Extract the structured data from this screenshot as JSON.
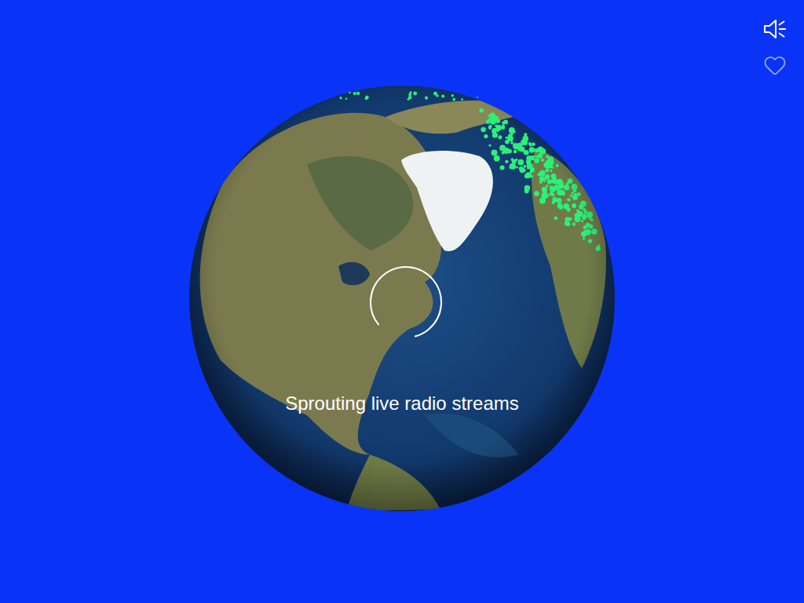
{
  "status": "Sprouting live radio streams",
  "sound": {
    "muted": false
  },
  "favorite": {
    "selected": false
  },
  "loading": {
    "level": 0.82
  }
}
